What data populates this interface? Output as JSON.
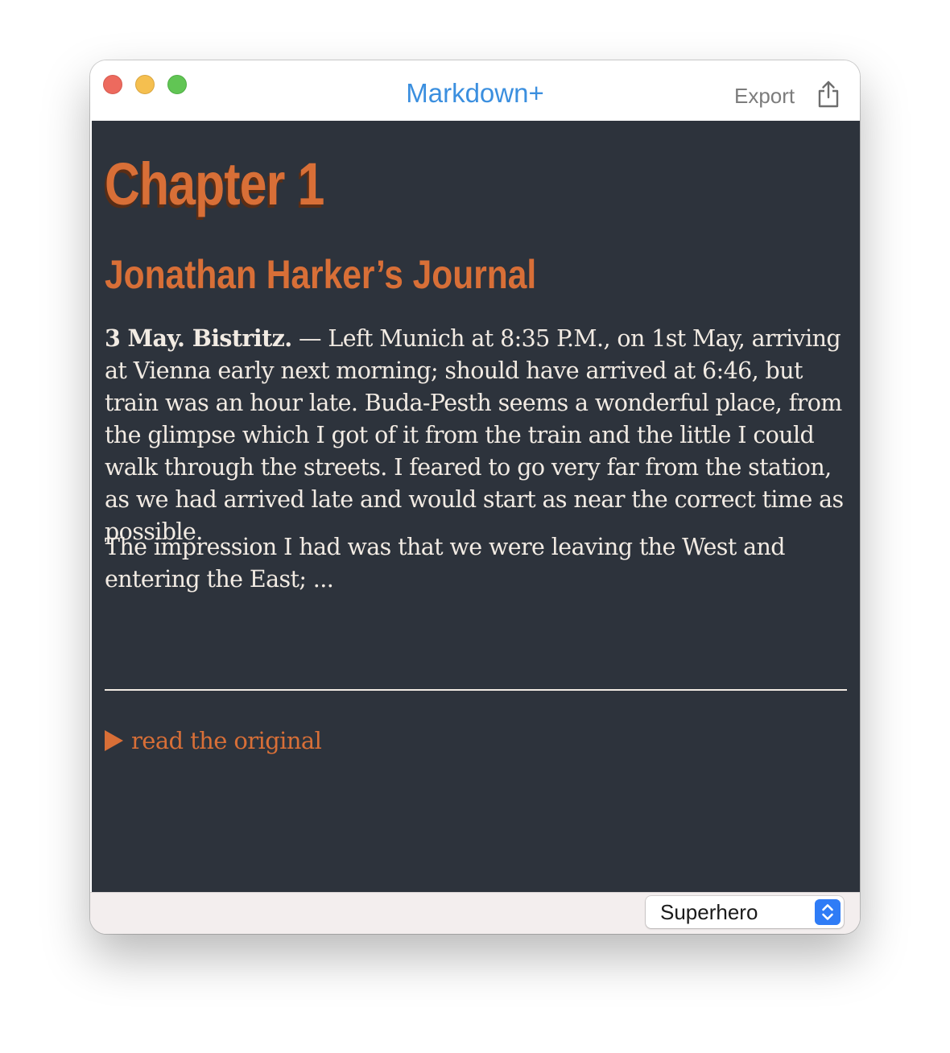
{
  "window": {
    "title": "Markdown+",
    "export_label": "Export",
    "accent_color": "#3b8fdf"
  },
  "document": {
    "chapter_title": "Chapter 1",
    "journal_title": "Jonathan Harker’s Journal",
    "para1_bold": "3 May. Bistritz.",
    "para1_text": " — Left Munich at 8:35 P.M., on 1st May, arriving at Vienna early next morning; should have arrived at 6:46, but train was an hour late. Buda-Pesth seems a wonderful place, from the glimpse which I got of it from the train and the little I could walk through the streets. I feared to go very far from the station, as we had arrived late and would start as near the correct time as possible.",
    "para2_text": "The impression I had was that we were leaving the West and entering the East; ...",
    "details_label": "read the original",
    "heading_color": "#d86f37",
    "background_color": "#2d333c",
    "text_color": "#f2ebe3"
  },
  "footer": {
    "theme_select_value": "Superhero"
  },
  "icons": {
    "close": "close-button",
    "minimize": "minimize-button",
    "maximize": "maximize-button",
    "share": "share-icon",
    "disclosure": "disclosure-triangle-icon",
    "stepper": "chevron-up-down-icon"
  }
}
